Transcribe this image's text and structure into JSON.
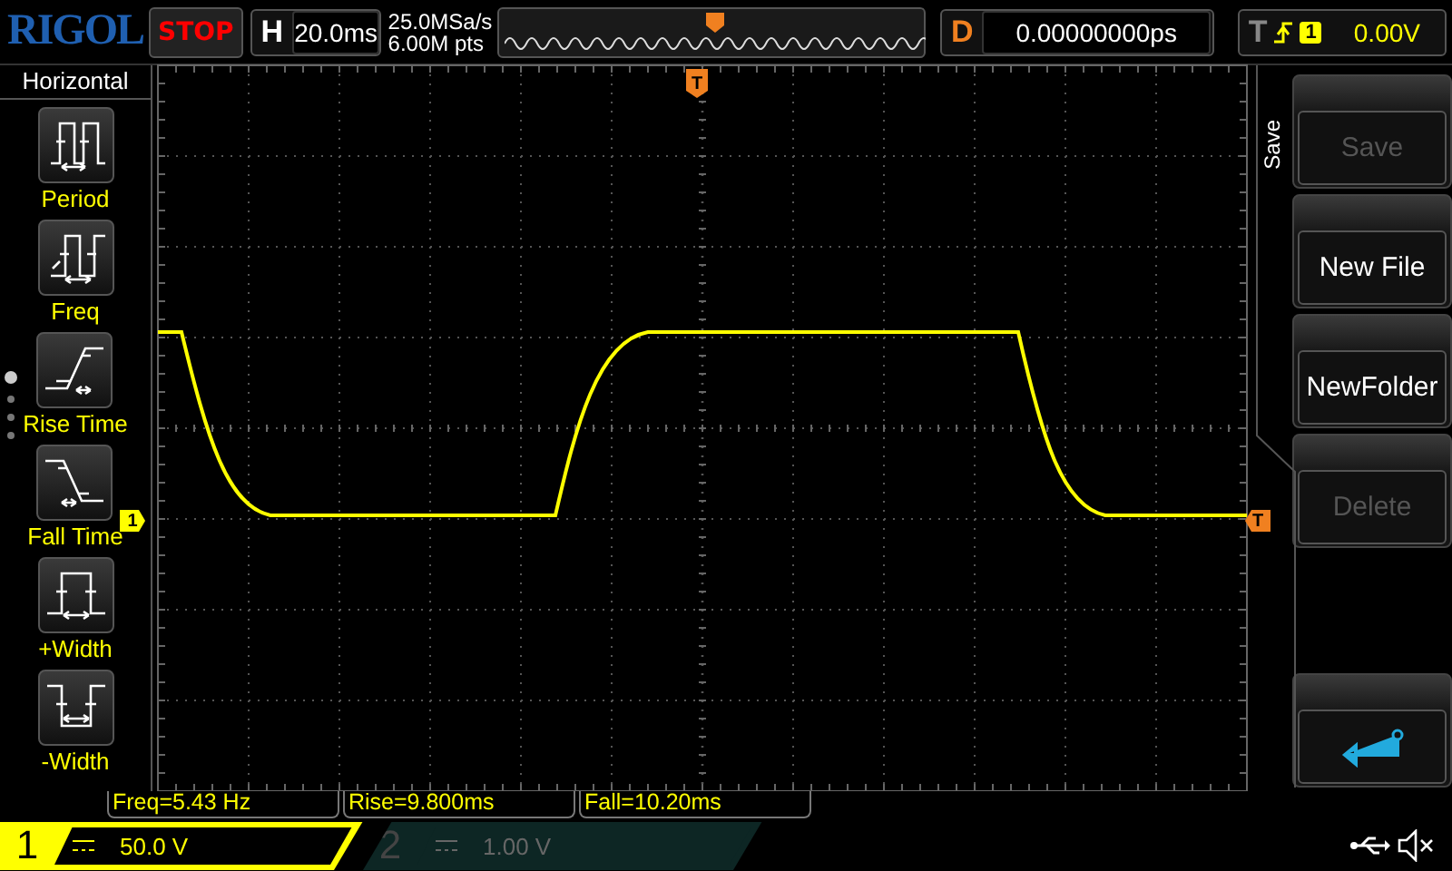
{
  "top_bar": {
    "logo": "RIGOL",
    "run_state": "STOP",
    "timebase": {
      "label": "H",
      "value": "20.0ms"
    },
    "sample_rate": "25.0MSa/s",
    "memory_depth": "6.00M pts",
    "delay": {
      "label": "D",
      "value": "0.00000000ps"
    },
    "trigger": {
      "label": "T",
      "source": "1",
      "level": "0.00V"
    }
  },
  "left_menu": {
    "title": "Horizontal",
    "items": [
      {
        "kind": "period",
        "label": "Period"
      },
      {
        "kind": "freq",
        "label": "Freq"
      },
      {
        "kind": "rise",
        "label": "Rise Time"
      },
      {
        "kind": "fall",
        "label": "Fall Time"
      },
      {
        "kind": "pwidth",
        "label": "+Width"
      },
      {
        "kind": "nwidth",
        "label": "-Width"
      }
    ]
  },
  "display": {
    "channel_marker": "1",
    "trigger_position_marker": "T",
    "trigger_level_marker": "T"
  },
  "softkeys": {
    "title": "Save",
    "keys": [
      {
        "kind": "text",
        "label": "Save",
        "disabled": true
      },
      {
        "kind": "text",
        "label": "New File",
        "disabled": false
      },
      {
        "kind": "text",
        "label": "NewFolder",
        "disabled": false
      },
      {
        "kind": "text",
        "label": "Delete",
        "disabled": true
      },
      {
        "kind": "return",
        "disabled": false
      }
    ]
  },
  "measurements": [
    "Freq=5.43 Hz",
    "Rise=9.800ms",
    "Fall=10.20ms"
  ],
  "channels": [
    {
      "number": "1",
      "scale": "50.0 V",
      "enabled": true
    },
    {
      "number": "2",
      "scale": "1.00 V",
      "enabled": false
    }
  ]
}
